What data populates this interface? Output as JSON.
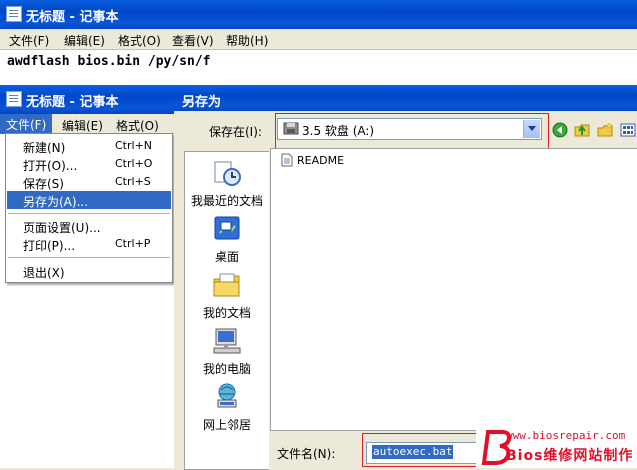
{
  "main_window": {
    "title": "无标题 - 记事本",
    "menu": [
      "文件(F)",
      "编辑(E)",
      "格式(O)",
      "查看(V)",
      "帮助(H)"
    ],
    "text": "awdflash bios.bin /py/sn/f"
  },
  "second_window": {
    "title": "无标题 - 记事本",
    "menu": [
      "文件(F)",
      "编辑(E)",
      "格式(O)"
    ]
  },
  "file_menu": {
    "items": [
      {
        "label": "新建(N)",
        "shortcut": "Ctrl+N"
      },
      {
        "label": "打开(O)...",
        "shortcut": "Ctrl+O"
      },
      {
        "label": "保存(S)",
        "shortcut": "Ctrl+S"
      },
      {
        "label": "另存为(A)...",
        "shortcut": ""
      },
      {
        "label": "页面设置(U)...",
        "shortcut": ""
      },
      {
        "label": "打印(P)...",
        "shortcut": "Ctrl+P"
      },
      {
        "label": "退出(X)",
        "shortcut": ""
      }
    ],
    "selected": "另存为(A)..."
  },
  "save_dialog": {
    "title": "另存为",
    "save_in_label": "保存在(I):",
    "save_in_value": "3.5 软盘 (A:)",
    "places": [
      "我最近的文档",
      "桌面",
      "我的文档",
      "我的电脑",
      "网上邻居"
    ],
    "files": [
      "README"
    ],
    "filename_label": "文件名(N):",
    "filename_value": "autoexec.bat"
  },
  "watermark": {
    "brand": "Bios维修网站制作",
    "url": "www.biosrepair.com"
  },
  "colors": {
    "titlebar": "#0054e3",
    "selection": "#316ac5",
    "highlight_box": "#d62020",
    "watermark": "#e0102a"
  }
}
